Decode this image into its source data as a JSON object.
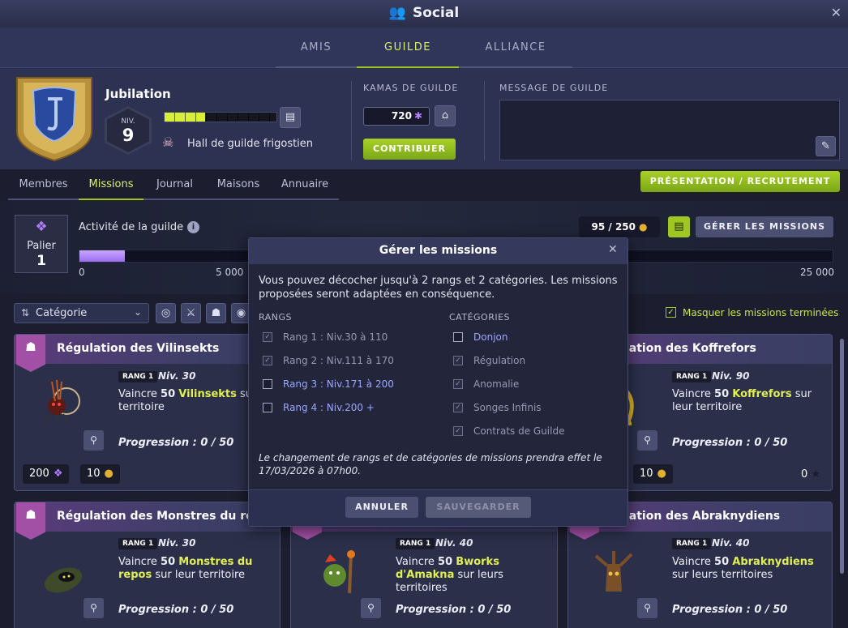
{
  "window": {
    "title": "Social",
    "close_icon": "close-icon",
    "title_icon": "social-icon"
  },
  "top_tabs": [
    {
      "label": "AMIS",
      "active": false
    },
    {
      "label": "GUILDE",
      "active": true
    },
    {
      "label": "ALLIANCE",
      "active": false
    }
  ],
  "guild": {
    "name": "Jubilation",
    "level_label": "NIV.",
    "level": "9",
    "xp_progress": 0.36,
    "hall": "Hall de guilde frigostien",
    "kamas_title": "KAMAS DE GUILDE",
    "kamas": "720",
    "kamas_icon": "✱",
    "contribute_label": "CONTRIBUER",
    "message_title": "MESSAGE DE GUILDE",
    "message": "",
    "presentation_label": "PRÉSENTATION / RECRUTEMENT"
  },
  "sub_tabs": [
    {
      "label": "Membres",
      "active": false
    },
    {
      "label": "Missions",
      "active": true
    },
    {
      "label": "Journal",
      "active": false
    },
    {
      "label": "Maisons",
      "active": false
    },
    {
      "label": "Annuaire",
      "active": false
    }
  ],
  "activity": {
    "palier_label": "Palier",
    "palier_value": "1",
    "title": "Activité de la guilde",
    "info_icon": "i",
    "progress": 0.06,
    "ticks": [
      "0",
      "5 000",
      "25 000"
    ],
    "count": "95 / 250",
    "manage_label": "GÉRER LES MISSIONS"
  },
  "filters": {
    "category_label": "Catégorie",
    "hide_completed_label": "Masquer les missions terminées",
    "hide_completed_checked": true
  },
  "missions": [
    {
      "title": "Régulation des Vilinsekts",
      "rang": "RANG 1",
      "niv": "Niv. 30",
      "verb": "Vaincre",
      "count": "50",
      "target": "Vilinsekts",
      "rest": "sur leur territoire",
      "progress": "Progression : 0 / 50",
      "reward_points": "200",
      "reward_coins": "10"
    },
    {
      "title": "ulation des Koffrefors",
      "rang": "RANG 1",
      "niv": "Niv. 90",
      "verb": "Vaincre",
      "count": "50",
      "target": "Koffrefors",
      "rest": "sur leur territoire",
      "progress": "Progression : 0 / 50",
      "reward_coins": "10",
      "stars": "0"
    },
    {
      "title": "Régulation des Monstres du repos",
      "rang": "RANG 1",
      "niv": "Niv. 30",
      "verb": "Vaincre",
      "count": "50",
      "target": "Monstres du repos",
      "rest": "sur leur territoire",
      "progress": "Progression : 0 / 50"
    },
    {
      "title": "",
      "rang": "RANG 1",
      "niv": "Niv. 40",
      "verb": "Vaincre",
      "count": "50",
      "target": "Bworks d'Amakna",
      "rest": "sur leurs territoires",
      "progress": "Progression : 0 / 50"
    },
    {
      "title": "ulation des Abraknydiens",
      "rang": "RANG 1",
      "niv": "Niv. 40",
      "verb": "Vaincre",
      "count": "50",
      "target": "Abraknydiens",
      "rest": "sur leurs territoires",
      "progress": "Progression : 0 / 50"
    }
  ],
  "modal": {
    "title": "Gérer les missions",
    "description": "Vous pouvez décocher jusqu'à 2 rangs et 2 catégories. Les missions proposées seront adaptées en conséquence.",
    "rangs_title": "RANGS",
    "categories_title": "CATÉGORIES",
    "rangs": [
      {
        "label": "Rang 1 : Niv.30 à 110",
        "checked": true,
        "enabled": false
      },
      {
        "label": "Rang 2 : Niv.111 à 170",
        "checked": true,
        "enabled": false
      },
      {
        "label": "Rang 3 : Niv.171 à 200",
        "checked": false,
        "enabled": true
      },
      {
        "label": "Rang 4 : Niv.200 +",
        "checked": false,
        "enabled": true
      }
    ],
    "categories": [
      {
        "label": "Donjon",
        "checked": false,
        "enabled": true
      },
      {
        "label": "Régulation",
        "checked": true,
        "enabled": false
      },
      {
        "label": "Anomalie",
        "checked": true,
        "enabled": false
      },
      {
        "label": "Songes Infinis",
        "checked": true,
        "enabled": false
      },
      {
        "label": "Contrats de Guilde",
        "checked": true,
        "enabled": false
      }
    ],
    "note": "Le changement de rangs et de catégories de missions prendra effet le 17/03/2026 à 07h00.",
    "cancel_label": "ANNULER",
    "save_label": "SAUVEGARDER"
  }
}
